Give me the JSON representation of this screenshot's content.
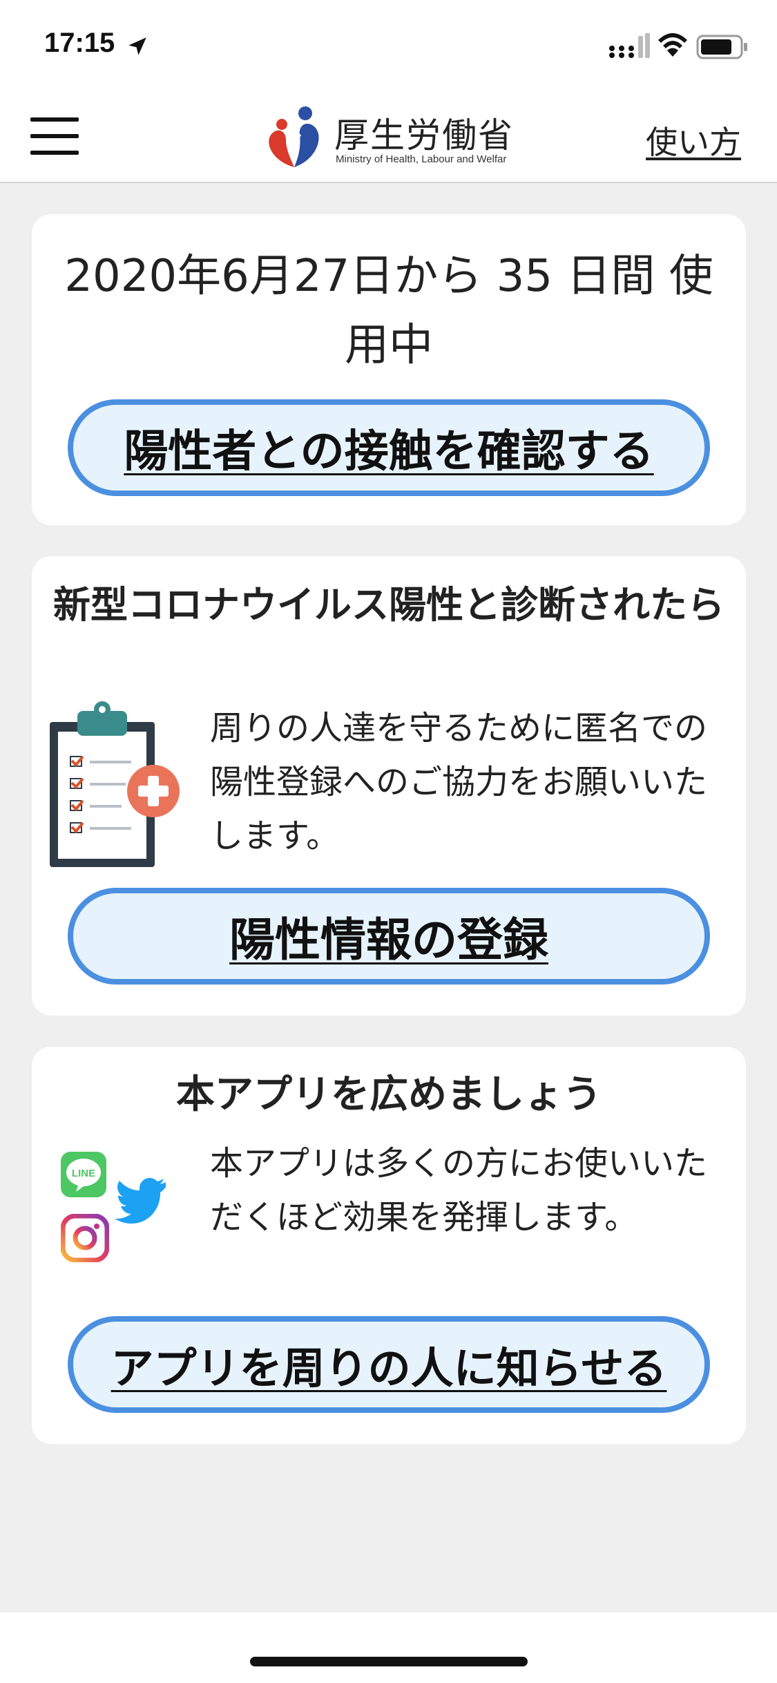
{
  "status_bar": {
    "time": "17:15",
    "icons": [
      "location-arrow-icon",
      "cellular-signal-icon",
      "wifi-icon",
      "battery-icon"
    ]
  },
  "nav": {
    "menu_icon": "hamburger-menu-icon",
    "logo_title": "厚生労働省",
    "logo_subtitle": "Ministry of Health, Labour and Welfar",
    "howto_label": "使い方"
  },
  "usage_card": {
    "usage_text": "2020年6月27日から 35 日間 使用中",
    "check_button_label": "陽性者との接触を確認する"
  },
  "register_card": {
    "heading": "新型コロナウイルス陽性と診断されたら",
    "body": "周りの人達を守るために匿名での陽性登録へのご協力をお願いいたします。",
    "icon": "clipboard-icon",
    "register_button_label": "陽性情報の登録"
  },
  "share_card": {
    "heading": "本アプリを広めましょう",
    "body": "本アプリは多くの方にお使いいただくほど効果を発揮します。",
    "icons": [
      "line-icon",
      "twitter-icon",
      "instagram-icon"
    ],
    "line_text": "LINE",
    "share_button_label": "アプリを周りの人に知らせる"
  },
  "colors": {
    "accent_border": "#4b8fe0",
    "button_fill": "#e6f3fc",
    "background": "#efefef"
  }
}
